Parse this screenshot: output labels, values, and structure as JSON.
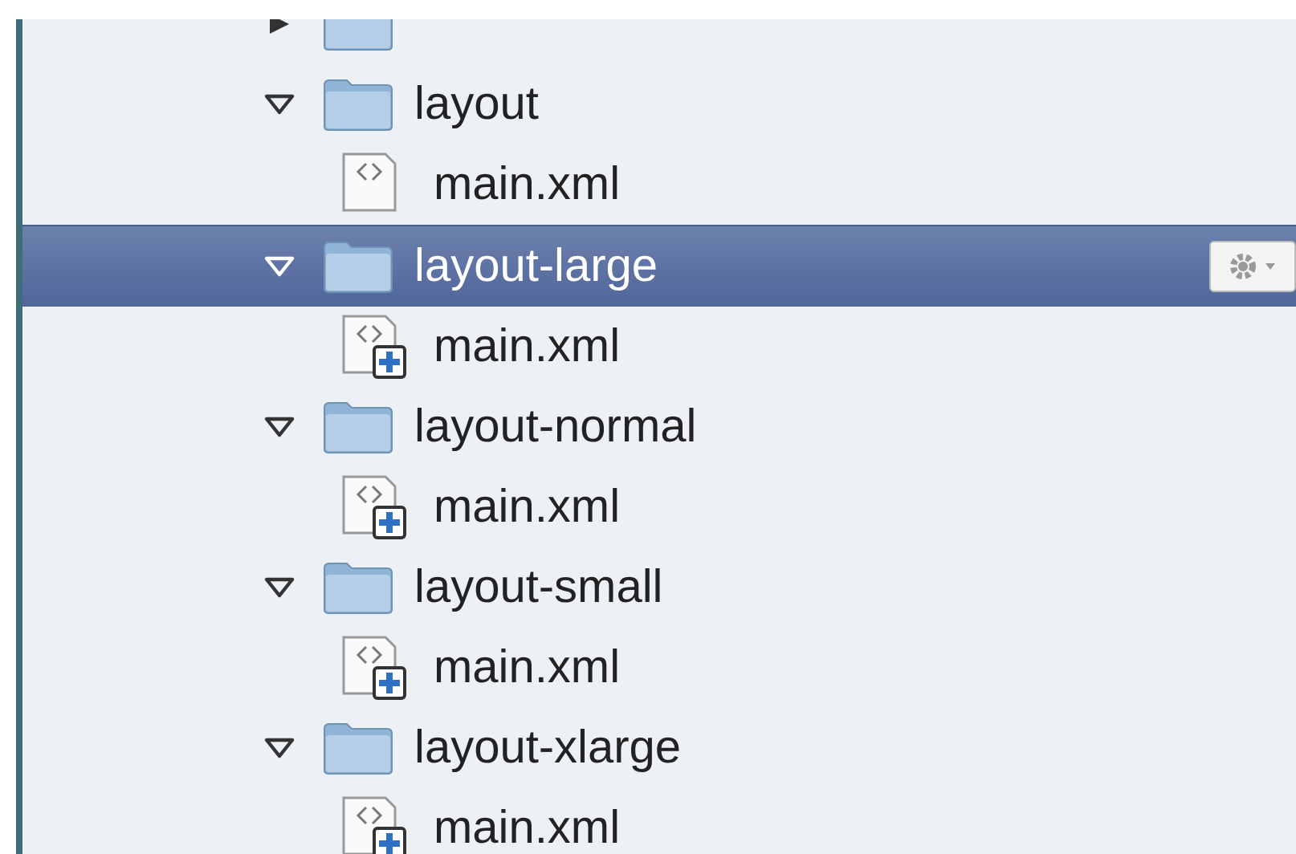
{
  "tree": {
    "items": [
      {
        "expanded": false,
        "selected": false
      },
      {
        "name": "layout",
        "expanded": true,
        "selected": false,
        "children": [
          {
            "name": "main.xml",
            "added": false
          }
        ]
      },
      {
        "name": "layout-large",
        "expanded": true,
        "selected": true,
        "children": [
          {
            "name": "main.xml",
            "added": true
          }
        ]
      },
      {
        "name": "layout-normal",
        "expanded": true,
        "selected": false,
        "children": [
          {
            "name": "main.xml",
            "added": true
          }
        ]
      },
      {
        "name": "layout-small",
        "expanded": true,
        "selected": false,
        "children": [
          {
            "name": "main.xml",
            "added": true
          }
        ]
      },
      {
        "name": "layout-xlarge",
        "expanded": true,
        "selected": false,
        "children": [
          {
            "name": "main.xml",
            "added": true
          }
        ]
      }
    ]
  }
}
